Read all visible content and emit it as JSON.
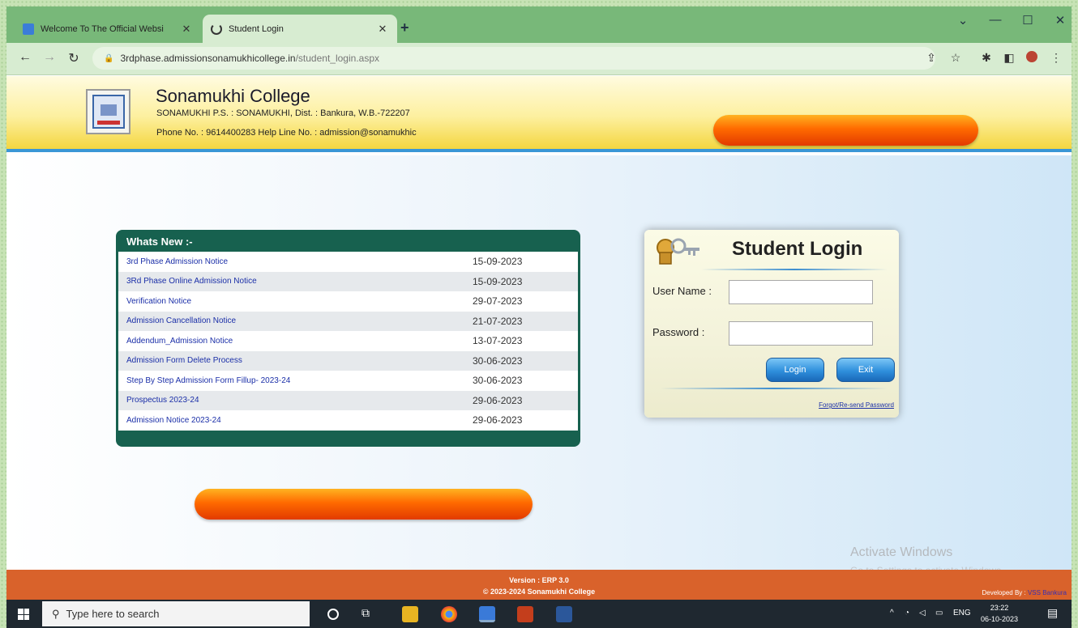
{
  "browser": {
    "tabs": [
      {
        "title": "Welcome To The Official Websi",
        "active": false
      },
      {
        "title": "Student Login",
        "active": true
      }
    ],
    "new_tab": "+",
    "address": {
      "host": "3rdphase.admissionsonamukhicollege.in",
      "path": "/student_login.aspx"
    }
  },
  "site": {
    "college_name": "Sonamukhi College",
    "address": "SONAMUKHI P.S. : SONAMUKHI, Dist. : Bankura, W.B.-722207",
    "phone_line": "Phone No. : 9614400283   Help Line No. : admission@sonamukhic"
  },
  "whats_new": {
    "title": "Whats New :-",
    "items": [
      {
        "label": "3rd Phase Admission Notice",
        "date": "15-09-2023"
      },
      {
        "label": "3Rd Phase Online Admission Notice",
        "date": "15-09-2023"
      },
      {
        "label": "Verification Notice",
        "date": "29-07-2023"
      },
      {
        "label": "Admission Cancellation Notice",
        "date": "21-07-2023"
      },
      {
        "label": "Addendum_Admission Notice",
        "date": "13-07-2023"
      },
      {
        "label": "Admission Form Delete Process",
        "date": "30-06-2023"
      },
      {
        "label": "Step By Step Admission Form Fillup- 2023-24",
        "date": "30-06-2023"
      },
      {
        "label": "Prospectus 2023-24",
        "date": "29-06-2023"
      },
      {
        "label": "Admission Notice 2023-24",
        "date": "29-06-2023"
      }
    ]
  },
  "login": {
    "title": "Student Login",
    "username_label": "User Name :",
    "password_label": "Password :",
    "username_value": "",
    "password_value": "",
    "login_button": "Login",
    "exit_button": "Exit",
    "forgot_link": "Forgot/Re-send Password"
  },
  "watermark": {
    "line1": "Activate Windows",
    "line2": "Go to Settings to activate Windows."
  },
  "footer": {
    "version": "Version : ERP 3.0",
    "copyright": "© 2023-2024  Sonamukhi College",
    "developed_by": "Developed By :",
    "developer": "VSS Bankura"
  },
  "taskbar": {
    "search_placeholder": "Type here to search",
    "language": "ENG",
    "time": "23:22",
    "date": "06-10-2023"
  },
  "colors": {
    "header_band": "#f4d640",
    "news_panel": "#17614f",
    "footer": "#d9622b",
    "accent_blue": "#3a97d6"
  }
}
